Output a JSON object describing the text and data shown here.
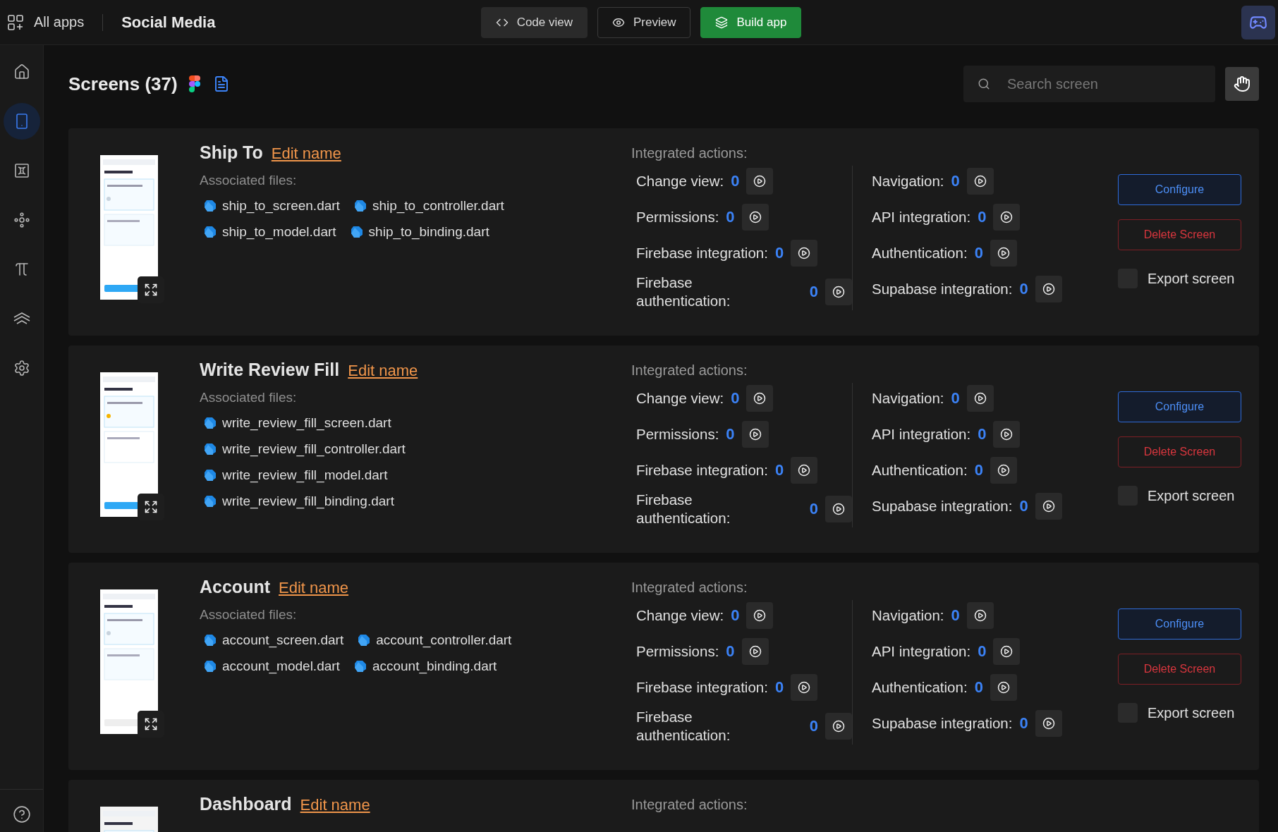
{
  "top_bar": {
    "apps_label": "All apps",
    "app_name": "Social Media",
    "buttons": [
      {
        "kind": "code",
        "label": "Code view"
      },
      {
        "kind": "preview",
        "label": "Preview"
      },
      {
        "kind": "build",
        "label": "Build app"
      }
    ]
  },
  "sidebar": {
    "items": [
      {
        "selected": false
      },
      {
        "selected": true
      },
      {
        "selected": false
      },
      {
        "selected": false
      },
      {
        "selected": false
      },
      {
        "selected": false
      },
      {
        "selected": false
      }
    ]
  },
  "header": {
    "title": "Screens (37)",
    "search": {
      "placeholder": "Search screen"
    }
  },
  "screens": [
    {
      "name": "Ship To",
      "edit": "Edit name",
      "files_label": "Associated files:",
      "files": [
        "ship_to_screen.dart",
        "ship_to_controller.dart",
        "ship_to_model.dart",
        "ship_to_binding.dart"
      ],
      "actions_label": "Integrated actions:",
      "left_actions": [
        {
          "label": "Change view:",
          "count": "0"
        },
        {
          "label": "Permissions:",
          "count": "0"
        },
        {
          "label": "Firebase integration:",
          "count": "0"
        },
        {
          "label": "Firebase authentication:",
          "count": "0"
        }
      ],
      "right_actions": [
        {
          "label": "Navigation:",
          "count": "0"
        },
        {
          "label": "API integration:",
          "count": "0"
        },
        {
          "label": "Authentication:",
          "count": "0"
        },
        {
          "label": "Supabase integration:",
          "count": "0"
        }
      ],
      "configure": "Configure",
      "delete": "Delete Screen",
      "export": {
        "label": "Export screen",
        "checked": false
      }
    },
    {
      "name": "Write Review Fill",
      "edit": "Edit name",
      "files_label": "Associated files:",
      "files": [
        "write_review_fill_screen.dart",
        "write_review_fill_controller.dart",
        "write_review_fill_model.dart",
        "write_review_fill_binding.dart"
      ],
      "actions_label": "Integrated actions:",
      "left_actions": [
        {
          "label": "Change view:",
          "count": "0"
        },
        {
          "label": "Permissions:",
          "count": "0"
        },
        {
          "label": "Firebase integration:",
          "count": "0"
        },
        {
          "label": "Firebase authentication:",
          "count": "0"
        }
      ],
      "right_actions": [
        {
          "label": "Navigation:",
          "count": "0"
        },
        {
          "label": "API integration:",
          "count": "0"
        },
        {
          "label": "Authentication:",
          "count": "0"
        },
        {
          "label": "Supabase integration:",
          "count": "0"
        }
      ],
      "configure": "Configure",
      "delete": "Delete Screen",
      "export": {
        "label": "Export screen",
        "checked": false
      }
    },
    {
      "name": "Account",
      "edit": "Edit name",
      "files_label": "Associated files:",
      "files": [
        "account_screen.dart",
        "account_controller.dart",
        "account_model.dart",
        "account_binding.dart"
      ],
      "actions_label": "Integrated actions:",
      "left_actions": [
        {
          "label": "Change view:",
          "count": "0"
        },
        {
          "label": "Permissions:",
          "count": "0"
        },
        {
          "label": "Firebase integration:",
          "count": "0"
        },
        {
          "label": "Firebase authentication:",
          "count": "0"
        }
      ],
      "right_actions": [
        {
          "label": "Navigation:",
          "count": "0"
        },
        {
          "label": "API integration:",
          "count": "0"
        },
        {
          "label": "Authentication:",
          "count": "0"
        },
        {
          "label": "Supabase integration:",
          "count": "0"
        }
      ],
      "configure": "Configure",
      "delete": "Delete Screen",
      "export": {
        "label": "Export screen",
        "checked": false
      }
    },
    {
      "name": "Dashboard",
      "edit": "Edit name",
      "actions_label": "Integrated actions:"
    }
  ]
}
